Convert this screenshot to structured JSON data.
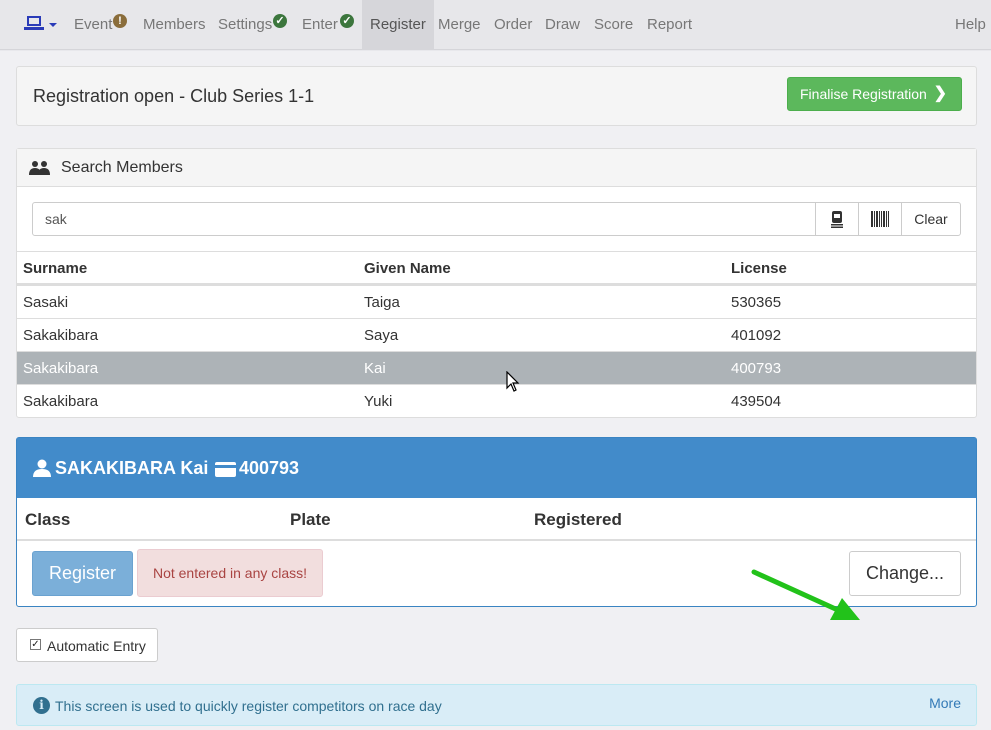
{
  "nav": {
    "items": [
      {
        "label": "Event",
        "badge": "!"
      },
      {
        "label": "Members"
      },
      {
        "label": "Settings",
        "badge": "✓"
      },
      {
        "label": "Enter",
        "badge": "✓"
      },
      {
        "label": "Register",
        "active": true
      },
      {
        "label": "Merge"
      },
      {
        "label": "Order"
      },
      {
        "label": "Draw"
      },
      {
        "label": "Score"
      },
      {
        "label": "Report"
      }
    ],
    "help": "Help",
    "logo_icon": "laptop-icon"
  },
  "header": {
    "title": "Registration open - Club Series 1-1",
    "finalise_label": "Finalise Registration"
  },
  "search": {
    "title": "Search Members",
    "value": "sak",
    "clear_label": "Clear",
    "columns": [
      "Surname",
      "Given Name",
      "License"
    ],
    "rows": [
      {
        "surname": "Sasaki",
        "given": "Taiga",
        "license": "530365"
      },
      {
        "surname": "Sakakibara",
        "given": "Saya",
        "license": "401092"
      },
      {
        "surname": "Sakakibara",
        "given": "Kai",
        "license": "400793",
        "selected": true
      },
      {
        "surname": "Sakakibara",
        "given": "Yuki",
        "license": "439504"
      }
    ]
  },
  "competitor": {
    "name": "SAKAKIBARA Kai",
    "license": "400793",
    "columns": [
      "Class",
      "Plate",
      "Registered"
    ],
    "register_label": "Register",
    "status": "Not entered in any class!",
    "change_label": "Change..."
  },
  "options": {
    "auto_entry_label": "Automatic Entry",
    "auto_entry_checked": true
  },
  "info": {
    "text": "This screen is used to quickly register competitors on race day",
    "more_label": "More"
  },
  "colors": {
    "primary": "#428bca",
    "success": "#5cb85c",
    "danger_bg": "#f2dede",
    "info_bg": "#d9edf7",
    "annotation_arrow": "#22c21a"
  }
}
